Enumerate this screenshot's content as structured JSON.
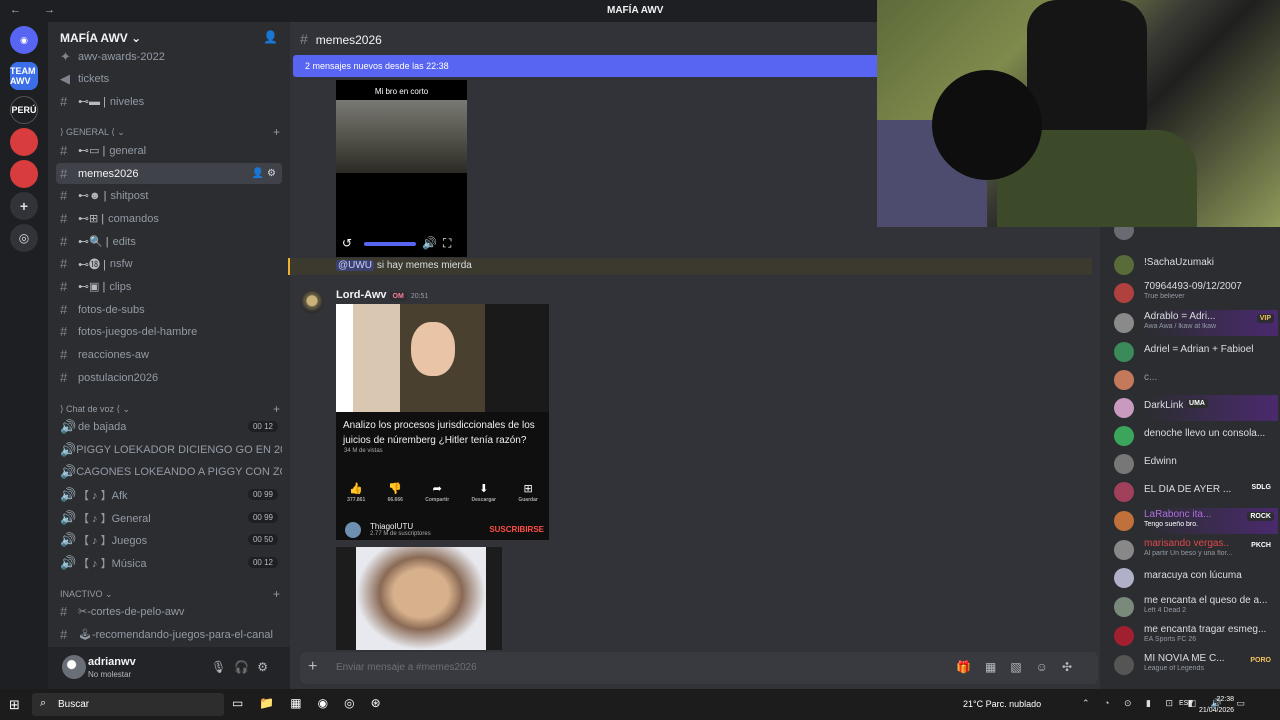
{
  "titlebar": {
    "title": "MAFÍA AWV",
    "nav": "← →"
  },
  "servers": [
    {
      "label": "",
      "color": "#5865f2"
    },
    {
      "label": "TEAM AWV",
      "color": "#3b6ee8"
    },
    {
      "label": "PERÚ",
      "color": "#1e1f22"
    },
    {
      "label": "",
      "color": "#d83c3e"
    },
    {
      "label": "",
      "color": "#d83c3e"
    },
    {
      "label": "+",
      "color": "#313338"
    },
    {
      "label": "◎",
      "color": "#313338"
    }
  ],
  "sidebar": {
    "guild_name": "MAFÍA AWV ⌄",
    "top_items": [
      "awv-awards-2022",
      "tickets",
      "niveles"
    ],
    "top_prefixes": [
      "",
      "",
      "⊷▬ |"
    ],
    "category_general": "⟩ GENERAL ⟨ ⌄",
    "channels": [
      {
        "name": "general",
        "prefix": "⊷▭ |"
      },
      {
        "name": "memes2026",
        "prefix": ""
      },
      {
        "name": "shitpost",
        "prefix": "⊷☻ |"
      },
      {
        "name": "comandos",
        "prefix": "⊷⊞ |"
      },
      {
        "name": "edits",
        "prefix": "⊷🔍 |"
      },
      {
        "name": "nsfw",
        "prefix": "⊷⓲ |"
      },
      {
        "name": "clips",
        "prefix": "⊷▣ |"
      },
      {
        "name": "fotos-de-subs",
        "prefix": ""
      },
      {
        "name": "fotos-juegos-del-hambre",
        "prefix": ""
      },
      {
        "name": "reacciones-aw",
        "prefix": ""
      },
      {
        "name": "postulacion2026",
        "prefix": ""
      }
    ],
    "category_voice": "⟩ Chat de voz ⟨ ⌄",
    "voice": [
      {
        "name": "de bajada",
        "count": "00 12"
      },
      {
        "name": "PIGGY LOEKADOR DICIENGO GO EN 20 ...",
        "count": ""
      },
      {
        "name": "CAGONES LOKEANDO A PIGGY CON ZO...",
        "count": ""
      },
      {
        "name": "【 ♪ 】Afk",
        "count": "00 99"
      },
      {
        "name": "【 ♪ 】General",
        "count": "00 99"
      },
      {
        "name": "【 ♪ 】Juegos",
        "count": "00 50"
      },
      {
        "name": "【 ♪ 】Música",
        "count": "00 12"
      }
    ],
    "category_inactive": "INACTIVO ⌄",
    "inactive": [
      "✂-cortes-de-pelo-awv",
      "🕹-recomendando-juegos-para-el-canal"
    ]
  },
  "user": {
    "name": "adrianwv",
    "status": "No molestar"
  },
  "channel": {
    "name": "memes2026",
    "new_messages": "2 mensajes nuevos desde las 22:38",
    "video_caption": "Mi bro en corto",
    "mention": "@UWU",
    "mention_text": " si hay memes mierda",
    "author": "Lord-Awv",
    "author_tag": "OM",
    "time": "20:51",
    "composer_placeholder": "Enviar mensaje a #memes2026"
  },
  "youtube": {
    "title": "Analizo los procesos jurisdiccionales de los juicios de núremberg ¿Hitler tenía razón?",
    "views": "34 M de vistas",
    "actions": [
      {
        "icon": "👍",
        "label": "377.861"
      },
      {
        "icon": "👎",
        "label": "66.666"
      },
      {
        "icon": "➦",
        "label": "Compartir"
      },
      {
        "icon": "⬇",
        "label": "Descargar"
      },
      {
        "icon": "⊞",
        "label": "Guardar"
      }
    ],
    "channel": "ThiagoIUTU",
    "subs": "2.77 M de suscriptores",
    "subscribe": "SUSCRIBIRSE"
  },
  "members": [
    {
      "name": "!SachaUzumaki",
      "status": "",
      "badge": "",
      "color": "#5a6b3a"
    },
    {
      "name": "70964493-09/12/2007",
      "status": "True believer",
      "badge": "",
      "color": "#b0413e"
    },
    {
      "name": "Adrablo = Adri...",
      "status": "Awa Awa / lkaw at lkaw",
      "badge": "VIP",
      "color": "#8a8a8a"
    },
    {
      "name": "Adriel = Adrian + Fabioel",
      "status": "",
      "badge": "",
      "color": "#3a8a5a"
    },
    {
      "name": "c...",
      "status": "",
      "badge": "",
      "color": "#c47a5a"
    },
    {
      "name": "DarkLink",
      "status": "",
      "badge": "UMA",
      "color": "#c89ac0"
    },
    {
      "name": "denoche llevo un consola...",
      "status": "",
      "badge": "",
      "color": "#3ba55c"
    },
    {
      "name": "Edwinn",
      "status": "",
      "badge": "",
      "color": "#777"
    },
    {
      "name": "EL DIA DE AYER ...",
      "status": "",
      "badge": "SDLG",
      "color": "#a0405a"
    },
    {
      "name": "LaRabonc ita...",
      "status": "Tengo sueño bro.",
      "badge": "ROCK",
      "color": "#c0703a"
    },
    {
      "name": "marisando vergas...",
      "status": "Al partir Un beso y una flor...",
      "badge": "PKCH",
      "color": "#888"
    },
    {
      "name": "maracuya con lúcuma",
      "status": "",
      "badge": "",
      "color": "#b0b0c8"
    },
    {
      "name": "me encanta el queso de a...",
      "status": "Left 4 Dead 2",
      "badge": "",
      "color": "#7a8a7a"
    },
    {
      "name": "me encanta tragar esmeg...",
      "status": "EA Sports FC 26",
      "badge": "",
      "color": "#a02030"
    },
    {
      "name": "MI NOVIA ME C...",
      "status": "League of Legends",
      "badge": "PORO",
      "color": "#555"
    }
  ],
  "taskbar": {
    "search": "Buscar",
    "weather": "21°C  Parc. nublado",
    "lang": "ESP",
    "time": "22:38",
    "date": "21/04/2026"
  }
}
